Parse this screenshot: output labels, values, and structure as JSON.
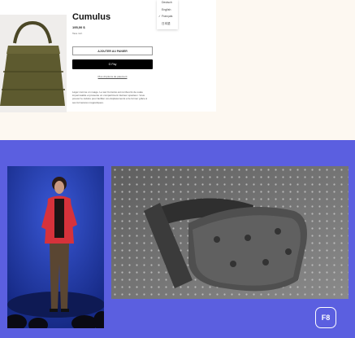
{
  "product": {
    "title": "Cumulus",
    "price": "195,00 $",
    "tax_note": "Taxe incl.",
    "add_to_cart": "AJOUTER AU PANIER",
    "gpay": "G Pay",
    "more_payment": "Plus d'options de paiement",
    "description": "Léger comme un nuage. Le sac Cumulus est rembourré de ouate imperméable et présente un compartiment intérieur spacieux. Vous pouvez le réduire pour faciliter vos déplacements et le fermer grâce à ses fermetures magnétiques."
  },
  "language_menu": {
    "options": [
      "Deutsch",
      "English",
      "Français",
      "日本語"
    ],
    "selected": "Français",
    "check_glyph": "✓"
  },
  "event": {
    "logo_text": "F8"
  },
  "colors": {
    "page_bg": "#fdf8f1",
    "stage_bg": "#5b5fe0",
    "pay_button": "#000000"
  }
}
